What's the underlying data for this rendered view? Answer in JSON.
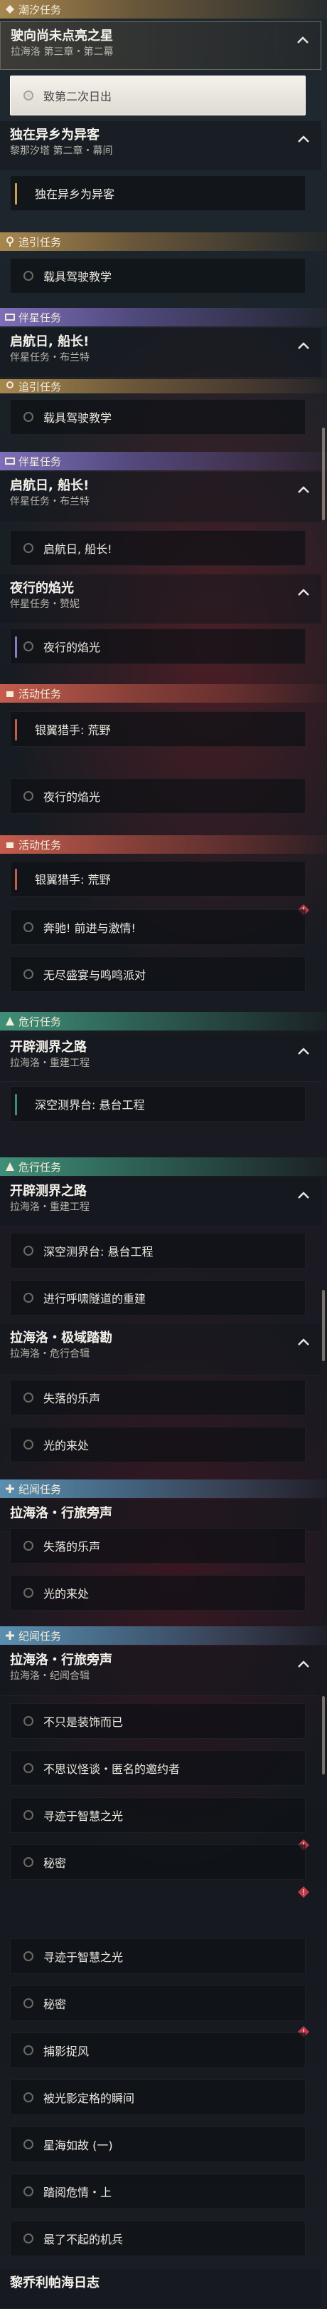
{
  "headers": {
    "h1": "潮汐任务",
    "h2": "追引任务",
    "h3": "伴星任务",
    "h4": "追引任务",
    "h5": "伴星任务",
    "h6": "活动任务",
    "h7": "活动任务",
    "h8": "危行任务",
    "h9": "危行任务",
    "h10": "纪闻任务",
    "h11": "纪闻任务"
  },
  "groups": {
    "g1": {
      "title": "驶向尚未点亮之星",
      "sub": "拉海洛 第三章・第二幕"
    },
    "g2": {
      "title": "独在异乡为异客",
      "sub": "黎那汐塔 第二章・幕间"
    },
    "g3": {
      "title": "启航日, 船长!",
      "sub": "伴星任务・布兰特"
    },
    "g4": {
      "title": "启航日, 船长!",
      "sub": "伴星任务・布兰特"
    },
    "g5": {
      "title": "夜行的焰光",
      "sub": "伴星任务・赞妮"
    },
    "g6": {
      "title": "开辟测界之路",
      "sub": "拉海洛・重建工程"
    },
    "g7": {
      "title": "开辟测界之路",
      "sub": "拉海洛・重建工程"
    },
    "g8": {
      "title": "拉海洛・极域踏勘",
      "sub": "拉海洛・危行合辑"
    },
    "g9": {
      "title": "拉海洛・行旅旁声"
    },
    "g10": {
      "title": "拉海洛・行旅旁声",
      "sub": "拉海洛・纪闻合辑"
    },
    "g11": {
      "title": "黎乔利帕海日志"
    }
  },
  "items": {
    "i1": "致第二次日出",
    "i2": "独在异乡为异客",
    "i3": "载具驾驶教学",
    "i4": "载具驾驶教学",
    "i5": "启航日, 船长!",
    "i6": "夜行的焰光",
    "i7": "银翼猎手: 荒野",
    "i8": "夜行的焰光",
    "i9": "银翼猎手: 荒野",
    "i10": "奔驰! 前进与激情!",
    "i11": "无尽盛宴与鸣鸣派对",
    "i12": "深空测界台: 悬台工程",
    "i13": "深空测界台: 悬台工程",
    "i14": "进行呼啸隧道的重建",
    "i15": "失落的乐声",
    "i16": "光的来处",
    "i17": "失落的乐声",
    "i18": "光的来处",
    "i19": "不只是装饰而已",
    "i20": "不思议怪谈・匿名的邀约者",
    "i21": "寻迹于智慧之光",
    "i22": "秘密",
    "i23": "寻迹于智慧之光",
    "i24": "秘密",
    "i25": "捕影捉风",
    "i26": "被光影定格的瞬间",
    "i27": "星海如故 (一)",
    "i28": "踏阅危情・上",
    "i29": "最了不起的机兵"
  },
  "colors": {
    "gold": "#a8864e",
    "purple": "#7d6fb8",
    "red": "#c45c4e",
    "green": "#3f8f78",
    "blue": "#5b8eb0",
    "alert": "#c23a4a"
  }
}
